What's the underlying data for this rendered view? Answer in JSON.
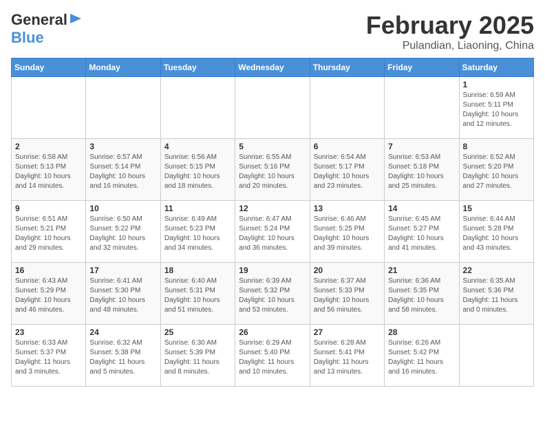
{
  "logo": {
    "general": "General",
    "blue": "Blue",
    "arrow": "►"
  },
  "title": "February 2025",
  "subtitle": "Pulandian, Liaoning, China",
  "days": [
    "Sunday",
    "Monday",
    "Tuesday",
    "Wednesday",
    "Thursday",
    "Friday",
    "Saturday"
  ],
  "weeks": [
    {
      "cells": [
        {
          "date": "",
          "info": ""
        },
        {
          "date": "",
          "info": ""
        },
        {
          "date": "",
          "info": ""
        },
        {
          "date": "",
          "info": ""
        },
        {
          "date": "",
          "info": ""
        },
        {
          "date": "",
          "info": ""
        },
        {
          "date": "1",
          "info": "Sunrise: 6:59 AM\nSunset: 5:11 PM\nDaylight: 10 hours\nand 12 minutes."
        }
      ]
    },
    {
      "cells": [
        {
          "date": "2",
          "info": "Sunrise: 6:58 AM\nSunset: 5:13 PM\nDaylight: 10 hours\nand 14 minutes."
        },
        {
          "date": "3",
          "info": "Sunrise: 6:57 AM\nSunset: 5:14 PM\nDaylight: 10 hours\nand 16 minutes."
        },
        {
          "date": "4",
          "info": "Sunrise: 6:56 AM\nSunset: 5:15 PM\nDaylight: 10 hours\nand 18 minutes."
        },
        {
          "date": "5",
          "info": "Sunrise: 6:55 AM\nSunset: 5:16 PM\nDaylight: 10 hours\nand 20 minutes."
        },
        {
          "date": "6",
          "info": "Sunrise: 6:54 AM\nSunset: 5:17 PM\nDaylight: 10 hours\nand 23 minutes."
        },
        {
          "date": "7",
          "info": "Sunrise: 6:53 AM\nSunset: 5:18 PM\nDaylight: 10 hours\nand 25 minutes."
        },
        {
          "date": "8",
          "info": "Sunrise: 6:52 AM\nSunset: 5:20 PM\nDaylight: 10 hours\nand 27 minutes."
        }
      ]
    },
    {
      "cells": [
        {
          "date": "9",
          "info": "Sunrise: 6:51 AM\nSunset: 5:21 PM\nDaylight: 10 hours\nand 29 minutes."
        },
        {
          "date": "10",
          "info": "Sunrise: 6:50 AM\nSunset: 5:22 PM\nDaylight: 10 hours\nand 32 minutes."
        },
        {
          "date": "11",
          "info": "Sunrise: 6:49 AM\nSunset: 5:23 PM\nDaylight: 10 hours\nand 34 minutes."
        },
        {
          "date": "12",
          "info": "Sunrise: 6:47 AM\nSunset: 5:24 PM\nDaylight: 10 hours\nand 36 minutes."
        },
        {
          "date": "13",
          "info": "Sunrise: 6:46 AM\nSunset: 5:25 PM\nDaylight: 10 hours\nand 39 minutes."
        },
        {
          "date": "14",
          "info": "Sunrise: 6:45 AM\nSunset: 5:27 PM\nDaylight: 10 hours\nand 41 minutes."
        },
        {
          "date": "15",
          "info": "Sunrise: 6:44 AM\nSunset: 5:28 PM\nDaylight: 10 hours\nand 43 minutes."
        }
      ]
    },
    {
      "cells": [
        {
          "date": "16",
          "info": "Sunrise: 6:43 AM\nSunset: 5:29 PM\nDaylight: 10 hours\nand 46 minutes."
        },
        {
          "date": "17",
          "info": "Sunrise: 6:41 AM\nSunset: 5:30 PM\nDaylight: 10 hours\nand 48 minutes."
        },
        {
          "date": "18",
          "info": "Sunrise: 6:40 AM\nSunset: 5:31 PM\nDaylight: 10 hours\nand 51 minutes."
        },
        {
          "date": "19",
          "info": "Sunrise: 6:39 AM\nSunset: 5:32 PM\nDaylight: 10 hours\nand 53 minutes."
        },
        {
          "date": "20",
          "info": "Sunrise: 6:37 AM\nSunset: 5:33 PM\nDaylight: 10 hours\nand 56 minutes."
        },
        {
          "date": "21",
          "info": "Sunrise: 6:36 AM\nSunset: 5:35 PM\nDaylight: 10 hours\nand 58 minutes."
        },
        {
          "date": "22",
          "info": "Sunrise: 6:35 AM\nSunset: 5:36 PM\nDaylight: 11 hours\nand 0 minutes."
        }
      ]
    },
    {
      "cells": [
        {
          "date": "23",
          "info": "Sunrise: 6:33 AM\nSunset: 5:37 PM\nDaylight: 11 hours\nand 3 minutes."
        },
        {
          "date": "24",
          "info": "Sunrise: 6:32 AM\nSunset: 5:38 PM\nDaylight: 11 hours\nand 5 minutes."
        },
        {
          "date": "25",
          "info": "Sunrise: 6:30 AM\nSunset: 5:39 PM\nDaylight: 11 hours\nand 8 minutes."
        },
        {
          "date": "26",
          "info": "Sunrise: 6:29 AM\nSunset: 5:40 PM\nDaylight: 11 hours\nand 10 minutes."
        },
        {
          "date": "27",
          "info": "Sunrise: 6:28 AM\nSunset: 5:41 PM\nDaylight: 11 hours\nand 13 minutes."
        },
        {
          "date": "28",
          "info": "Sunrise: 6:26 AM\nSunset: 5:42 PM\nDaylight: 11 hours\nand 16 minutes."
        },
        {
          "date": "",
          "info": ""
        }
      ]
    }
  ]
}
